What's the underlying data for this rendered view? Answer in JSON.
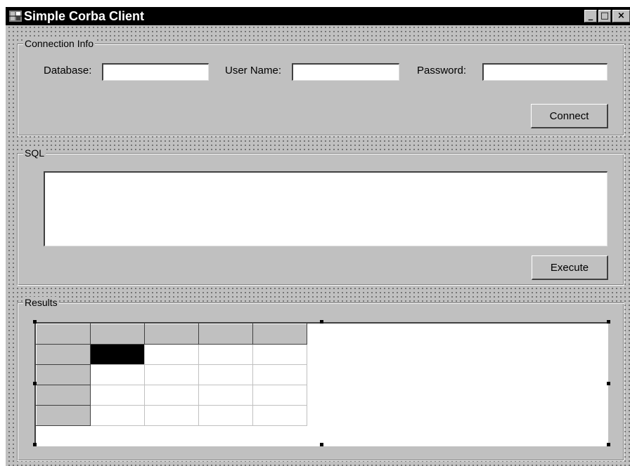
{
  "window": {
    "title": "Simple Corba Client",
    "controls": {
      "minimize": "_",
      "maximize": "□",
      "close": "×"
    }
  },
  "connection": {
    "legend": "Connection Info",
    "database_label": "Database:",
    "database_value": "",
    "username_label": "User Name:",
    "username_value": "",
    "password_label": "Password:",
    "password_value": "",
    "connect_label": "Connect"
  },
  "sql": {
    "legend": "SQL",
    "query_value": "",
    "execute_label": "Execute"
  },
  "results": {
    "legend": "Results",
    "grid": {
      "columns": 5,
      "rows": 5,
      "fixed_rows": 1,
      "fixed_cols": 1,
      "selected_cell": [
        1,
        1
      ]
    }
  },
  "colors": {
    "titlebar": "#000000",
    "face": "#c0c0c0",
    "selection": "#000000"
  }
}
